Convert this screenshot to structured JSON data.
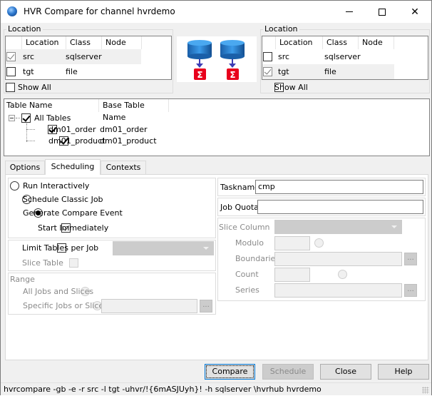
{
  "window": {
    "title": "HVR Compare for channel hvrdemo",
    "controls": {
      "minimize": "minimize",
      "maximize": "maximize",
      "close": "close"
    }
  },
  "left_location": {
    "group_label": "Location",
    "columns": [
      "Location",
      "Class",
      "Node"
    ],
    "rows": [
      {
        "checked": true,
        "location": "src",
        "class": "sqlserver",
        "node": ""
      },
      {
        "checked": false,
        "location": "tgt",
        "class": "file",
        "node": ""
      }
    ],
    "show_all_label": "Show All",
    "show_all_checked": false
  },
  "right_location": {
    "group_label": "Location",
    "columns": [
      "Location",
      "Class",
      "Node"
    ],
    "rows": [
      {
        "checked": false,
        "location": "src",
        "class": "sqlserver",
        "node": ""
      },
      {
        "checked": true,
        "location": "tgt",
        "class": "file",
        "node": ""
      }
    ],
    "show_all_label": "Show All",
    "show_all_checked": false
  },
  "diagram": {
    "icons": [
      "database-icon",
      "sigma-compare-icon",
      "database-icon",
      "sigma-compare-icon"
    ],
    "db_color": "#1f77c8",
    "sigma_color": "#e8001c",
    "arrow_color": "#3c3cb4",
    "sigma_glyph": "Σ"
  },
  "tables": {
    "columns": [
      "Table Name",
      "Base Table Name"
    ],
    "root": {
      "label": "All Tables",
      "checked": true
    },
    "items": [
      {
        "name": "dm01_order",
        "base": "dm01_order",
        "checked": true
      },
      {
        "name": "dm01_product",
        "base": "dm01_product",
        "checked": true
      }
    ]
  },
  "tabs": [
    {
      "label": "Options",
      "active": false
    },
    {
      "label": "Scheduling",
      "active": true
    },
    {
      "label": "Contexts",
      "active": false
    }
  ],
  "scheduling": {
    "mode_options": [
      {
        "label": "Run Interactively",
        "selected": false
      },
      {
        "label": "Schedule Classic Job",
        "selected": false
      },
      {
        "label": "Generate Compare Event",
        "selected": true
      }
    ],
    "start_immediately": {
      "label": "Start Immediately",
      "checked": true
    },
    "limit_tables": {
      "label": "Limit Tables per Job",
      "checked": false,
      "value": ""
    },
    "slice_table": {
      "label": "Slice Table",
      "checked": false
    },
    "range": {
      "label": "Range",
      "options": [
        {
          "label": "All Jobs and Slices",
          "selected": false
        },
        {
          "label": "Specific Jobs or Slices",
          "selected": false,
          "value": ""
        }
      ],
      "browse_label": "..."
    },
    "taskname": {
      "label": "Taskname",
      "value": "cmp"
    },
    "job_quota": {
      "label": "Job Quota",
      "value": ""
    },
    "slice_column": {
      "label": "Slice Column",
      "value": ""
    },
    "slice_options": [
      {
        "label": "Modulo",
        "value": ""
      },
      {
        "label": "Boundaries",
        "value": "",
        "browse_label": "..."
      },
      {
        "label": "Count",
        "value": ""
      },
      {
        "label": "Series",
        "value": "",
        "browse_label": "..."
      }
    ]
  },
  "buttons": {
    "compare": "Compare",
    "schedule": "Schedule",
    "close": "Close",
    "help": "Help"
  },
  "status": {
    "command": "hvrcompare -gb -e -r src -l tgt -uhvr/!{6mASJUyh}! -h sqlserver \\hvrhub hvrdemo"
  }
}
